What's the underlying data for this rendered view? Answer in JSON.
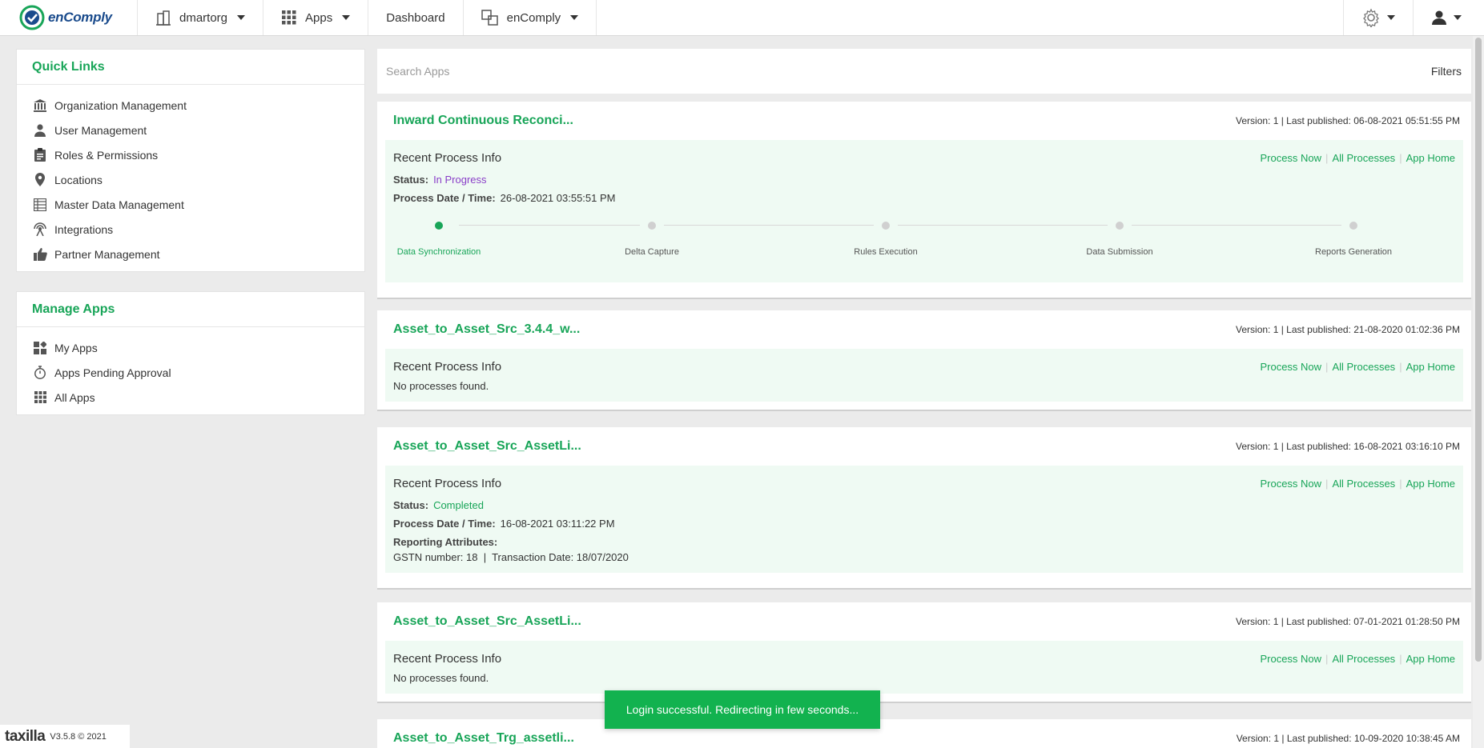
{
  "brand": {
    "name": "enComply"
  },
  "topnav": {
    "org": "dmartorg",
    "apps": "Apps",
    "dashboard": "Dashboard",
    "product": "enComply"
  },
  "quick_links": {
    "title": "Quick Links",
    "items": [
      {
        "label": "Organization Management",
        "icon": "bank-icon"
      },
      {
        "label": "User Management",
        "icon": "user-icon"
      },
      {
        "label": "Roles & Permissions",
        "icon": "clipboard-icon"
      },
      {
        "label": "Locations",
        "icon": "map-pin-icon"
      },
      {
        "label": "Master Data Management",
        "icon": "table-icon"
      },
      {
        "label": "Integrations",
        "icon": "antenna-icon"
      },
      {
        "label": "Partner Management",
        "icon": "thumbs-up-icon"
      }
    ]
  },
  "manage_apps": {
    "title": "Manage Apps",
    "items": [
      {
        "label": "My Apps",
        "icon": "widgets-icon"
      },
      {
        "label": "Apps Pending Approval",
        "icon": "stopwatch-icon"
      },
      {
        "label": "All Apps",
        "icon": "grid-icon"
      }
    ]
  },
  "search": {
    "placeholder": "Search Apps",
    "filters": "Filters"
  },
  "common": {
    "recent_process_info": "Recent Process Info",
    "process_now": "Process Now",
    "all_processes": "All Processes",
    "app_home": "App Home",
    "status_label": "Status:",
    "process_date_label": "Process Date / Time:",
    "reporting_attributes_label": "Reporting Attributes:",
    "no_processes": "No processes found."
  },
  "cards": [
    {
      "title": "Inward Continuous Reconci...",
      "version": "Version: 1 | Last published: 06-08-2021 05:51:55 PM",
      "status": "In Progress",
      "process_date": "26-08-2021 03:55:51 PM",
      "steps": [
        "Data Synchronization",
        "Delta Capture",
        "Rules Execution",
        "Data Submission",
        "Reports Generation"
      ],
      "active_step": 0
    },
    {
      "title": "Asset_to_Asset_Src_3.4.4_w...",
      "version": "Version: 1 | Last published: 21-08-2020 01:02:36 PM"
    },
    {
      "title": "Asset_to_Asset_Src_AssetLi...",
      "version": "Version: 1 | Last published: 16-08-2021 03:16:10 PM",
      "status": "Completed",
      "process_date": "16-08-2021 03:11:22 PM",
      "attributes": "GSTN number: 18  |  Transaction Date: 18/07/2020"
    },
    {
      "title": "Asset_to_Asset_Src_AssetLi...",
      "version": "Version: 1 | Last published: 07-01-2021 01:28:50 PM"
    },
    {
      "title": "Asset_to_Asset_Trg_assetli...",
      "version": "Version: 1 | Last published: 10-09-2020 10:38:45 AM"
    }
  ],
  "toast": "Login successful. Redirecting in few seconds...",
  "footer": {
    "logo": "taxilla",
    "version": "V3.5.8 © 2021"
  },
  "colors": {
    "accent": "#18a558",
    "in_progress": "#8a3ec8",
    "toast": "#12b24f"
  }
}
